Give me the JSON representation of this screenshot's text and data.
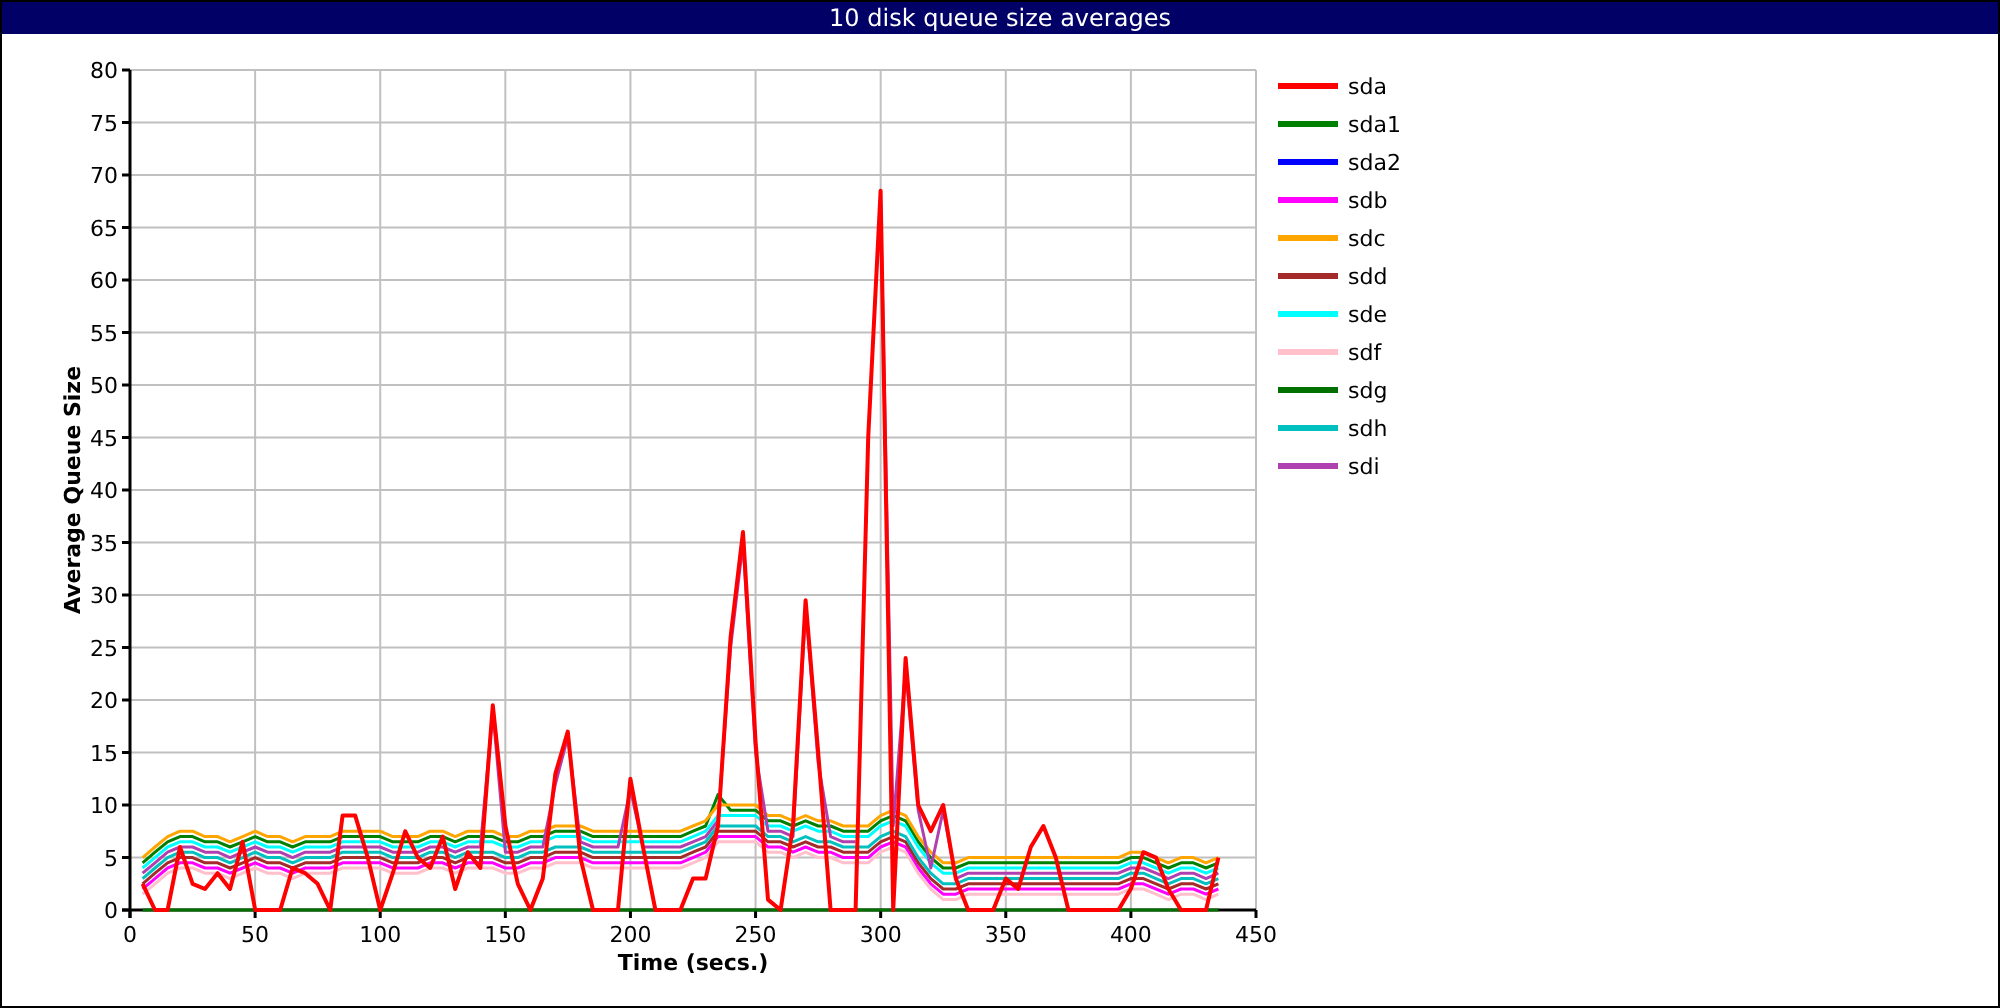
{
  "window": {
    "title": "10 disk queue size averages"
  },
  "chart_data": {
    "type": "line",
    "xlabel": "Time (secs.)",
    "ylabel": "Average Queue Size",
    "xlim": [
      0,
      450
    ],
    "ylim": [
      0,
      80
    ],
    "grid": true,
    "legend": true,
    "xticks": [
      0,
      50,
      100,
      150,
      200,
      250,
      300,
      350,
      400,
      450
    ],
    "yticks": [
      0,
      5,
      10,
      15,
      20,
      25,
      30,
      35,
      40,
      45,
      50,
      55,
      60,
      65,
      70,
      75,
      80
    ],
    "x": [
      5,
      10,
      15,
      20,
      25,
      30,
      35,
      40,
      45,
      50,
      55,
      60,
      65,
      70,
      75,
      80,
      85,
      90,
      95,
      100,
      105,
      110,
      115,
      120,
      125,
      130,
      135,
      140,
      145,
      150,
      155,
      160,
      165,
      170,
      175,
      180,
      185,
      190,
      195,
      200,
      205,
      210,
      215,
      220,
      225,
      230,
      235,
      240,
      245,
      250,
      255,
      260,
      265,
      270,
      275,
      280,
      285,
      290,
      295,
      300,
      305,
      310,
      315,
      320,
      325,
      330,
      335,
      340,
      345,
      350,
      355,
      360,
      365,
      370,
      375,
      380,
      385,
      390,
      395,
      400,
      405,
      410,
      415,
      420,
      425,
      430,
      435
    ],
    "series": [
      {
        "name": "sda",
        "color": "#ff0000",
        "values": [
          2.5,
          0,
          0,
          6,
          2.5,
          2,
          3.5,
          2,
          6.5,
          0,
          0,
          0,
          4,
          3.5,
          2.5,
          0,
          9,
          9,
          5,
          0,
          3.5,
          7.5,
          5,
          4,
          7,
          2,
          5.5,
          4,
          19.5,
          8,
          2.5,
          0,
          3,
          13,
          17,
          5,
          0,
          0,
          0,
          12.5,
          6,
          0,
          0,
          0,
          3,
          3,
          8,
          26,
          36,
          16,
          1,
          0,
          8,
          29.5,
          15,
          0,
          0,
          0,
          45,
          68.5,
          0,
          24,
          10,
          7.5,
          10,
          3,
          0,
          0,
          0,
          3,
          2,
          6,
          8,
          5,
          0,
          0,
          0,
          0,
          0,
          2,
          5.5,
          5,
          2,
          0,
          0,
          0,
          5
        ]
      },
      {
        "name": "sda1",
        "color": "#008000",
        "values": [
          4.5,
          5.5,
          6.5,
          7,
          7,
          6.5,
          6.5,
          6,
          6.5,
          7,
          6.5,
          6.5,
          6,
          6.5,
          6.5,
          6.5,
          7,
          7,
          7,
          7,
          6.5,
          6.5,
          6.5,
          7,
          7,
          6.5,
          7,
          7,
          7,
          6.5,
          6.5,
          7,
          7,
          7.5,
          7.5,
          7.5,
          7,
          7,
          7,
          7,
          7,
          7,
          7,
          7,
          7.5,
          8,
          11,
          9.5,
          9.5,
          9.5,
          8.5,
          8.5,
          8,
          8.5,
          8,
          8,
          7.5,
          7.5,
          7.5,
          8.5,
          9,
          8.5,
          6.5,
          5,
          4,
          4,
          4.5,
          4.5,
          4.5,
          4.5,
          4.5,
          4.5,
          4.5,
          4.5,
          4.5,
          4.5,
          4.5,
          4.5,
          4.5,
          5,
          5,
          4.5,
          4,
          4.5,
          4.5,
          4,
          4.5
        ]
      },
      {
        "name": "sda2",
        "color": "#0000ff",
        "values": [
          null,
          null,
          null,
          null,
          null,
          null,
          null,
          null,
          null,
          null,
          null,
          null,
          null,
          null,
          null,
          null,
          null,
          null,
          null,
          null,
          null,
          null,
          null,
          null,
          null,
          null,
          null,
          null,
          null,
          null,
          null,
          null,
          null,
          null,
          null,
          null,
          null,
          null,
          null,
          null,
          null,
          null,
          null,
          null,
          null,
          null,
          null,
          null,
          null,
          null,
          null,
          null,
          null,
          null,
          null,
          null,
          null,
          null,
          null,
          null,
          null,
          null,
          null,
          null,
          null,
          null,
          null,
          null,
          null,
          null,
          null,
          null,
          null,
          null,
          null,
          null,
          null,
          null,
          null,
          null,
          null,
          null,
          null,
          null,
          null,
          null,
          null
        ]
      },
      {
        "name": "sdb",
        "color": "#ff00ff",
        "values": [
          2,
          3,
          4,
          4.5,
          4.5,
          4,
          4,
          3.5,
          4,
          4.5,
          4,
          4,
          3.5,
          4,
          4,
          4,
          4.5,
          4.5,
          4.5,
          4.5,
          4,
          4,
          4,
          4.5,
          4.5,
          4,
          4.5,
          4.5,
          4.5,
          4,
          4,
          4.5,
          4.5,
          5,
          5,
          5,
          4.5,
          4.5,
          4.5,
          4.5,
          4.5,
          4.5,
          4.5,
          4.5,
          5,
          5.5,
          7,
          7,
          7,
          7,
          6,
          6,
          5.5,
          6,
          5.5,
          5.5,
          5,
          5,
          5,
          6,
          6.5,
          6,
          4,
          2.5,
          1.5,
          1.5,
          2,
          2,
          2,
          2,
          2,
          2,
          2,
          2,
          2,
          2,
          2,
          2,
          2,
          2.5,
          2.5,
          2,
          1.5,
          2,
          2,
          1.5,
          2
        ]
      },
      {
        "name": "sdc",
        "color": "#ffa500",
        "values": [
          5,
          6,
          7,
          7.5,
          7.5,
          7,
          7,
          6.5,
          7,
          7.5,
          7,
          7,
          6.5,
          7,
          7,
          7,
          7.5,
          7.5,
          7.5,
          7.5,
          7,
          7,
          7,
          7.5,
          7.5,
          7,
          7.5,
          7.5,
          7.5,
          7,
          7,
          7.5,
          7.5,
          8,
          8,
          8,
          7.5,
          7.5,
          7.5,
          7.5,
          7.5,
          7.5,
          7.5,
          7.5,
          8,
          8.5,
          10,
          10,
          10,
          10,
          9,
          9,
          8.5,
          9,
          8.5,
          8.5,
          8,
          8,
          8,
          9,
          9.5,
          9,
          7,
          5.5,
          4.5,
          4.5,
          5,
          5,
          5,
          5,
          5,
          5,
          5,
          5,
          5,
          5,
          5,
          5,
          5,
          5.5,
          5.5,
          5,
          4.5,
          5,
          5,
          4.5,
          5
        ]
      },
      {
        "name": "sdd",
        "color": "#a52a2a",
        "values": [
          2.5,
          3.5,
          4.5,
          5,
          5,
          4.5,
          4.5,
          4,
          4.5,
          5,
          4.5,
          4.5,
          4,
          4.5,
          4.5,
          4.5,
          5,
          5,
          5,
          5,
          4.5,
          4.5,
          4.5,
          5,
          5,
          4.5,
          5,
          5,
          5,
          4.5,
          4.5,
          5,
          5,
          5.5,
          5.5,
          5.5,
          5,
          5,
          5,
          5,
          5,
          5,
          5,
          5,
          5.5,
          6,
          7.5,
          7.5,
          7.5,
          7.5,
          6.5,
          6.5,
          6,
          6.5,
          6,
          6,
          5.5,
          5.5,
          5.5,
          6.5,
          7,
          6.5,
          4.5,
          3,
          2,
          2,
          2.5,
          2.5,
          2.5,
          2.5,
          2.5,
          2.5,
          2.5,
          2.5,
          2.5,
          2.5,
          2.5,
          2.5,
          2.5,
          3,
          3,
          2.5,
          2,
          2.5,
          2.5,
          2,
          2.5
        ]
      },
      {
        "name": "sde",
        "color": "#00ffff",
        "values": [
          4,
          5,
          6,
          6.5,
          6.5,
          6,
          6,
          5.5,
          6,
          6.5,
          6,
          6,
          5.5,
          6,
          6,
          6,
          6.5,
          6.5,
          6.5,
          6.5,
          6,
          6,
          6,
          6.5,
          6.5,
          6,
          6.5,
          6.5,
          6.5,
          6,
          6,
          6.5,
          6.5,
          7,
          7,
          7,
          6.5,
          6.5,
          6.5,
          6.5,
          6.5,
          6.5,
          6.5,
          6.5,
          7,
          7.5,
          9,
          9,
          9,
          9,
          8,
          8,
          7.5,
          8,
          7.5,
          7.5,
          7,
          7,
          7,
          8,
          8.5,
          8,
          6,
          4.5,
          3.5,
          3.5,
          4,
          4,
          4,
          4,
          4,
          4,
          4,
          4,
          4,
          4,
          4,
          4,
          4,
          4.5,
          4.5,
          4,
          3.5,
          4,
          4,
          3.5,
          4
        ]
      },
      {
        "name": "sdf",
        "color": "#ffc0cb",
        "values": [
          1.5,
          2.5,
          3.5,
          4,
          4,
          3.5,
          3.5,
          3,
          3.5,
          4,
          3.5,
          3.5,
          3,
          3.5,
          3.5,
          3.5,
          4,
          4,
          4,
          4,
          3.5,
          3.5,
          3.5,
          4,
          4,
          3.5,
          4,
          4,
          4,
          3.5,
          3.5,
          4,
          4,
          4.5,
          4.5,
          4.5,
          4,
          4,
          4,
          4,
          4,
          4,
          4,
          4,
          4.5,
          5,
          6.5,
          6.5,
          6.5,
          6.5,
          5.5,
          5.5,
          5,
          5.5,
          5,
          5,
          4.5,
          4.5,
          4.5,
          5.5,
          6,
          5.5,
          3.5,
          2,
          1,
          1,
          1.5,
          1.5,
          1.5,
          1.5,
          1.5,
          1.5,
          1.5,
          1.5,
          1.5,
          1.5,
          1.5,
          1.5,
          1.5,
          2,
          2,
          1.5,
          1,
          1.5,
          1.5,
          1,
          1.5
        ]
      },
      {
        "name": "sdg",
        "color": "#007000",
        "values": [
          0,
          0,
          0,
          0,
          0,
          0,
          0,
          0,
          0,
          0,
          0,
          0,
          0,
          0,
          0,
          0,
          0,
          0,
          0,
          0,
          0,
          0,
          0,
          0,
          0,
          0,
          0,
          0,
          0,
          0,
          0,
          0,
          0,
          0,
          0,
          0,
          0,
          0,
          0,
          0,
          0,
          0,
          0,
          0,
          0,
          0,
          0,
          0,
          0,
          0,
          0,
          0,
          0,
          0,
          0,
          0,
          0,
          0,
          0,
          0,
          0,
          0,
          0,
          0,
          0,
          0,
          0,
          0,
          0,
          0,
          0,
          0,
          0,
          0,
          0,
          0,
          0,
          0,
          0,
          0,
          0,
          0,
          0,
          0,
          0,
          0,
          0
        ]
      },
      {
        "name": "sdh",
        "color": "#00c0c0",
        "values": [
          3,
          4,
          5,
          5.5,
          5.5,
          5,
          5,
          4.5,
          5,
          5.5,
          5,
          5,
          4.5,
          5,
          5,
          5,
          5.5,
          5.5,
          5.5,
          5.5,
          5,
          5,
          5,
          5.5,
          5.5,
          5,
          5.5,
          5.5,
          5.5,
          5,
          5,
          5.5,
          5.5,
          6,
          6,
          6,
          5.5,
          5.5,
          5.5,
          5.5,
          5.5,
          5.5,
          5.5,
          5.5,
          6,
          6.5,
          8,
          8,
          8,
          8,
          7,
          7,
          6.5,
          7,
          6.5,
          6.5,
          6,
          6,
          6,
          7,
          7.5,
          7,
          5,
          3.5,
          2.5,
          2.5,
          3,
          3,
          3,
          3,
          3,
          3,
          3,
          3,
          3,
          3,
          3,
          3,
          3,
          3.5,
          3.5,
          3,
          2.5,
          3,
          3,
          2.5,
          3
        ]
      },
      {
        "name": "sdi",
        "color": "#b040b0",
        "values": [
          3.5,
          4.5,
          5.5,
          6,
          6,
          5.5,
          5.5,
          5,
          5.5,
          6,
          5.5,
          5.5,
          5,
          5.5,
          5.5,
          5.5,
          6,
          6,
          6,
          6,
          5.5,
          5.5,
          5.5,
          6,
          6,
          5.5,
          6,
          6,
          19,
          5.5,
          5.5,
          6,
          6,
          12,
          16.5,
          6.5,
          6,
          6,
          6,
          11.5,
          6,
          6,
          6,
          6,
          6.5,
          7,
          8.5,
          25,
          35,
          15,
          7.5,
          7.5,
          7,
          29,
          14,
          7,
          6.5,
          6.5,
          null,
          67.5,
          8,
          23,
          9.5,
          4,
          9.5,
          3,
          3.5,
          3.5,
          3.5,
          3.5,
          3.5,
          3.5,
          3.5,
          3.5,
          3.5,
          3.5,
          3.5,
          3.5,
          3.5,
          4,
          4,
          3.5,
          3,
          3.5,
          3.5,
          3,
          3.5
        ]
      }
    ]
  }
}
